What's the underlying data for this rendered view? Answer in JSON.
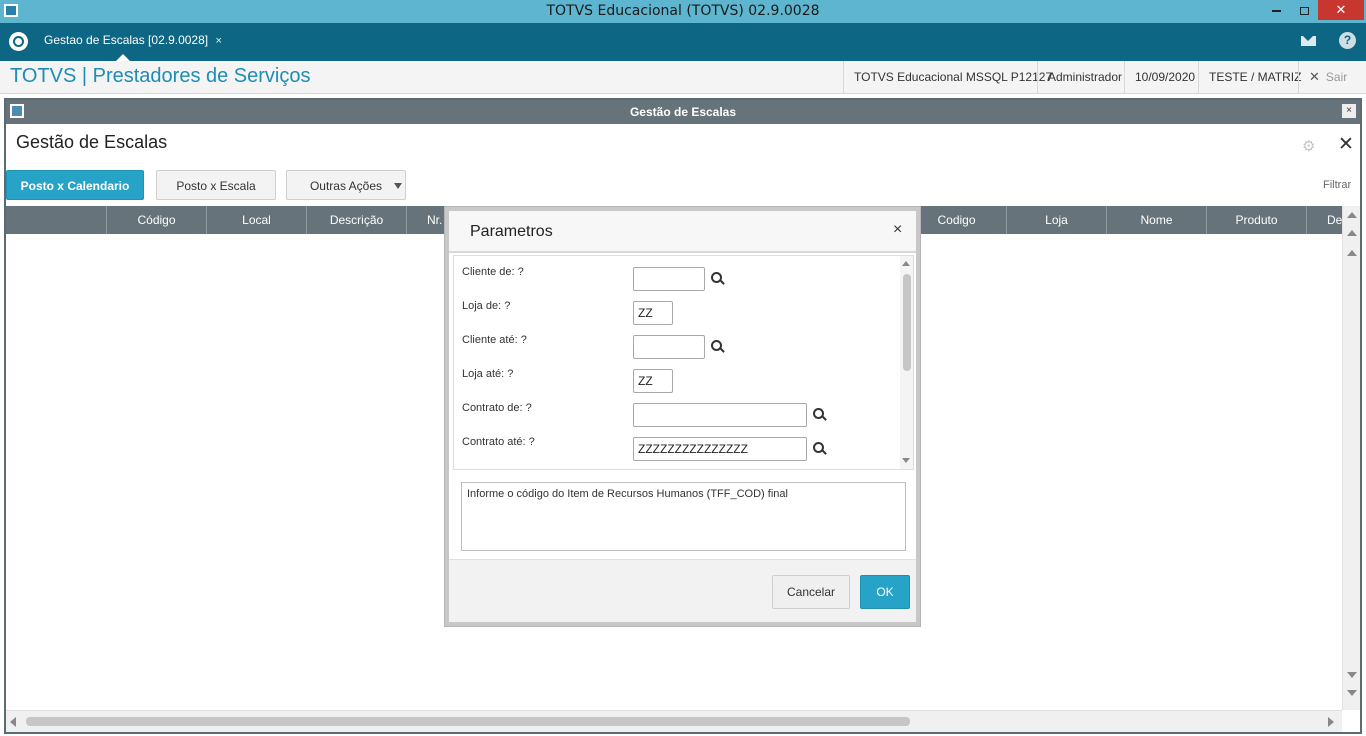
{
  "window": {
    "title": "TOTVS Educacional (TOTVS) 02.9.0028",
    "minimize_icon": "minimize-icon",
    "maximize_icon": "restore-icon",
    "close_glyph": "✕"
  },
  "tabbar": {
    "tab_label": "Gestao de Escalas [02.9.0028]",
    "tab_close": "×",
    "icons": [
      "totvs-logo-icon",
      "mail-icon",
      "help-icon"
    ],
    "help_glyph": "?"
  },
  "module": {
    "title": "TOTVS | Prestadores de Serviços",
    "environment": "TOTVS Educacional MSSQL P12127",
    "user": "Administrador",
    "date": "10/09/2020",
    "branch": "TESTE / MATRIZ",
    "logout_label": "Sair",
    "logout_glyph": "✕"
  },
  "inner_window": {
    "title": "Gestão de Escalas",
    "close_glyph": "×"
  },
  "page": {
    "title": "Gestão de Escalas",
    "gear_glyph": "⚙",
    "close_glyph": "✕",
    "buttons": {
      "posto_calendario": "Posto x Calendario",
      "posto_escala": "Posto x Escala",
      "outras_acoes": "Outras Ações"
    },
    "filter_label": "Filtrar"
  },
  "grid": {
    "left_columns": [
      "Código",
      "Local",
      "Descrição",
      "Nr. C"
    ],
    "right_columns": [
      "Codigo",
      "Loja",
      "Nome",
      "Produto",
      "De"
    ]
  },
  "modal": {
    "title": "Parametros",
    "close_glyph": "×",
    "params": [
      {
        "label": "Cliente de: ?",
        "value": ""
      },
      {
        "label": "Loja de: ?",
        "value": "ZZ"
      },
      {
        "label": "Cliente até: ?",
        "value": ""
      },
      {
        "label": "Loja até: ?",
        "value": "ZZ"
      },
      {
        "label": "Contrato de: ?",
        "value": ""
      },
      {
        "label": "Contrato até: ?",
        "value": "ZZZZZZZZZZZZZZZ"
      }
    ],
    "help_text": "Informe o código do Item de Recursos Humanos (TFF_COD) final",
    "cancel_label": "Cancelar",
    "ok_label": "OK"
  },
  "colors": {
    "titlebar": "#5eb5cf",
    "tabbar": "#0d6683",
    "accent": "#27a3c7",
    "grid_header": "#66737a",
    "close_red": "#c7372f"
  }
}
